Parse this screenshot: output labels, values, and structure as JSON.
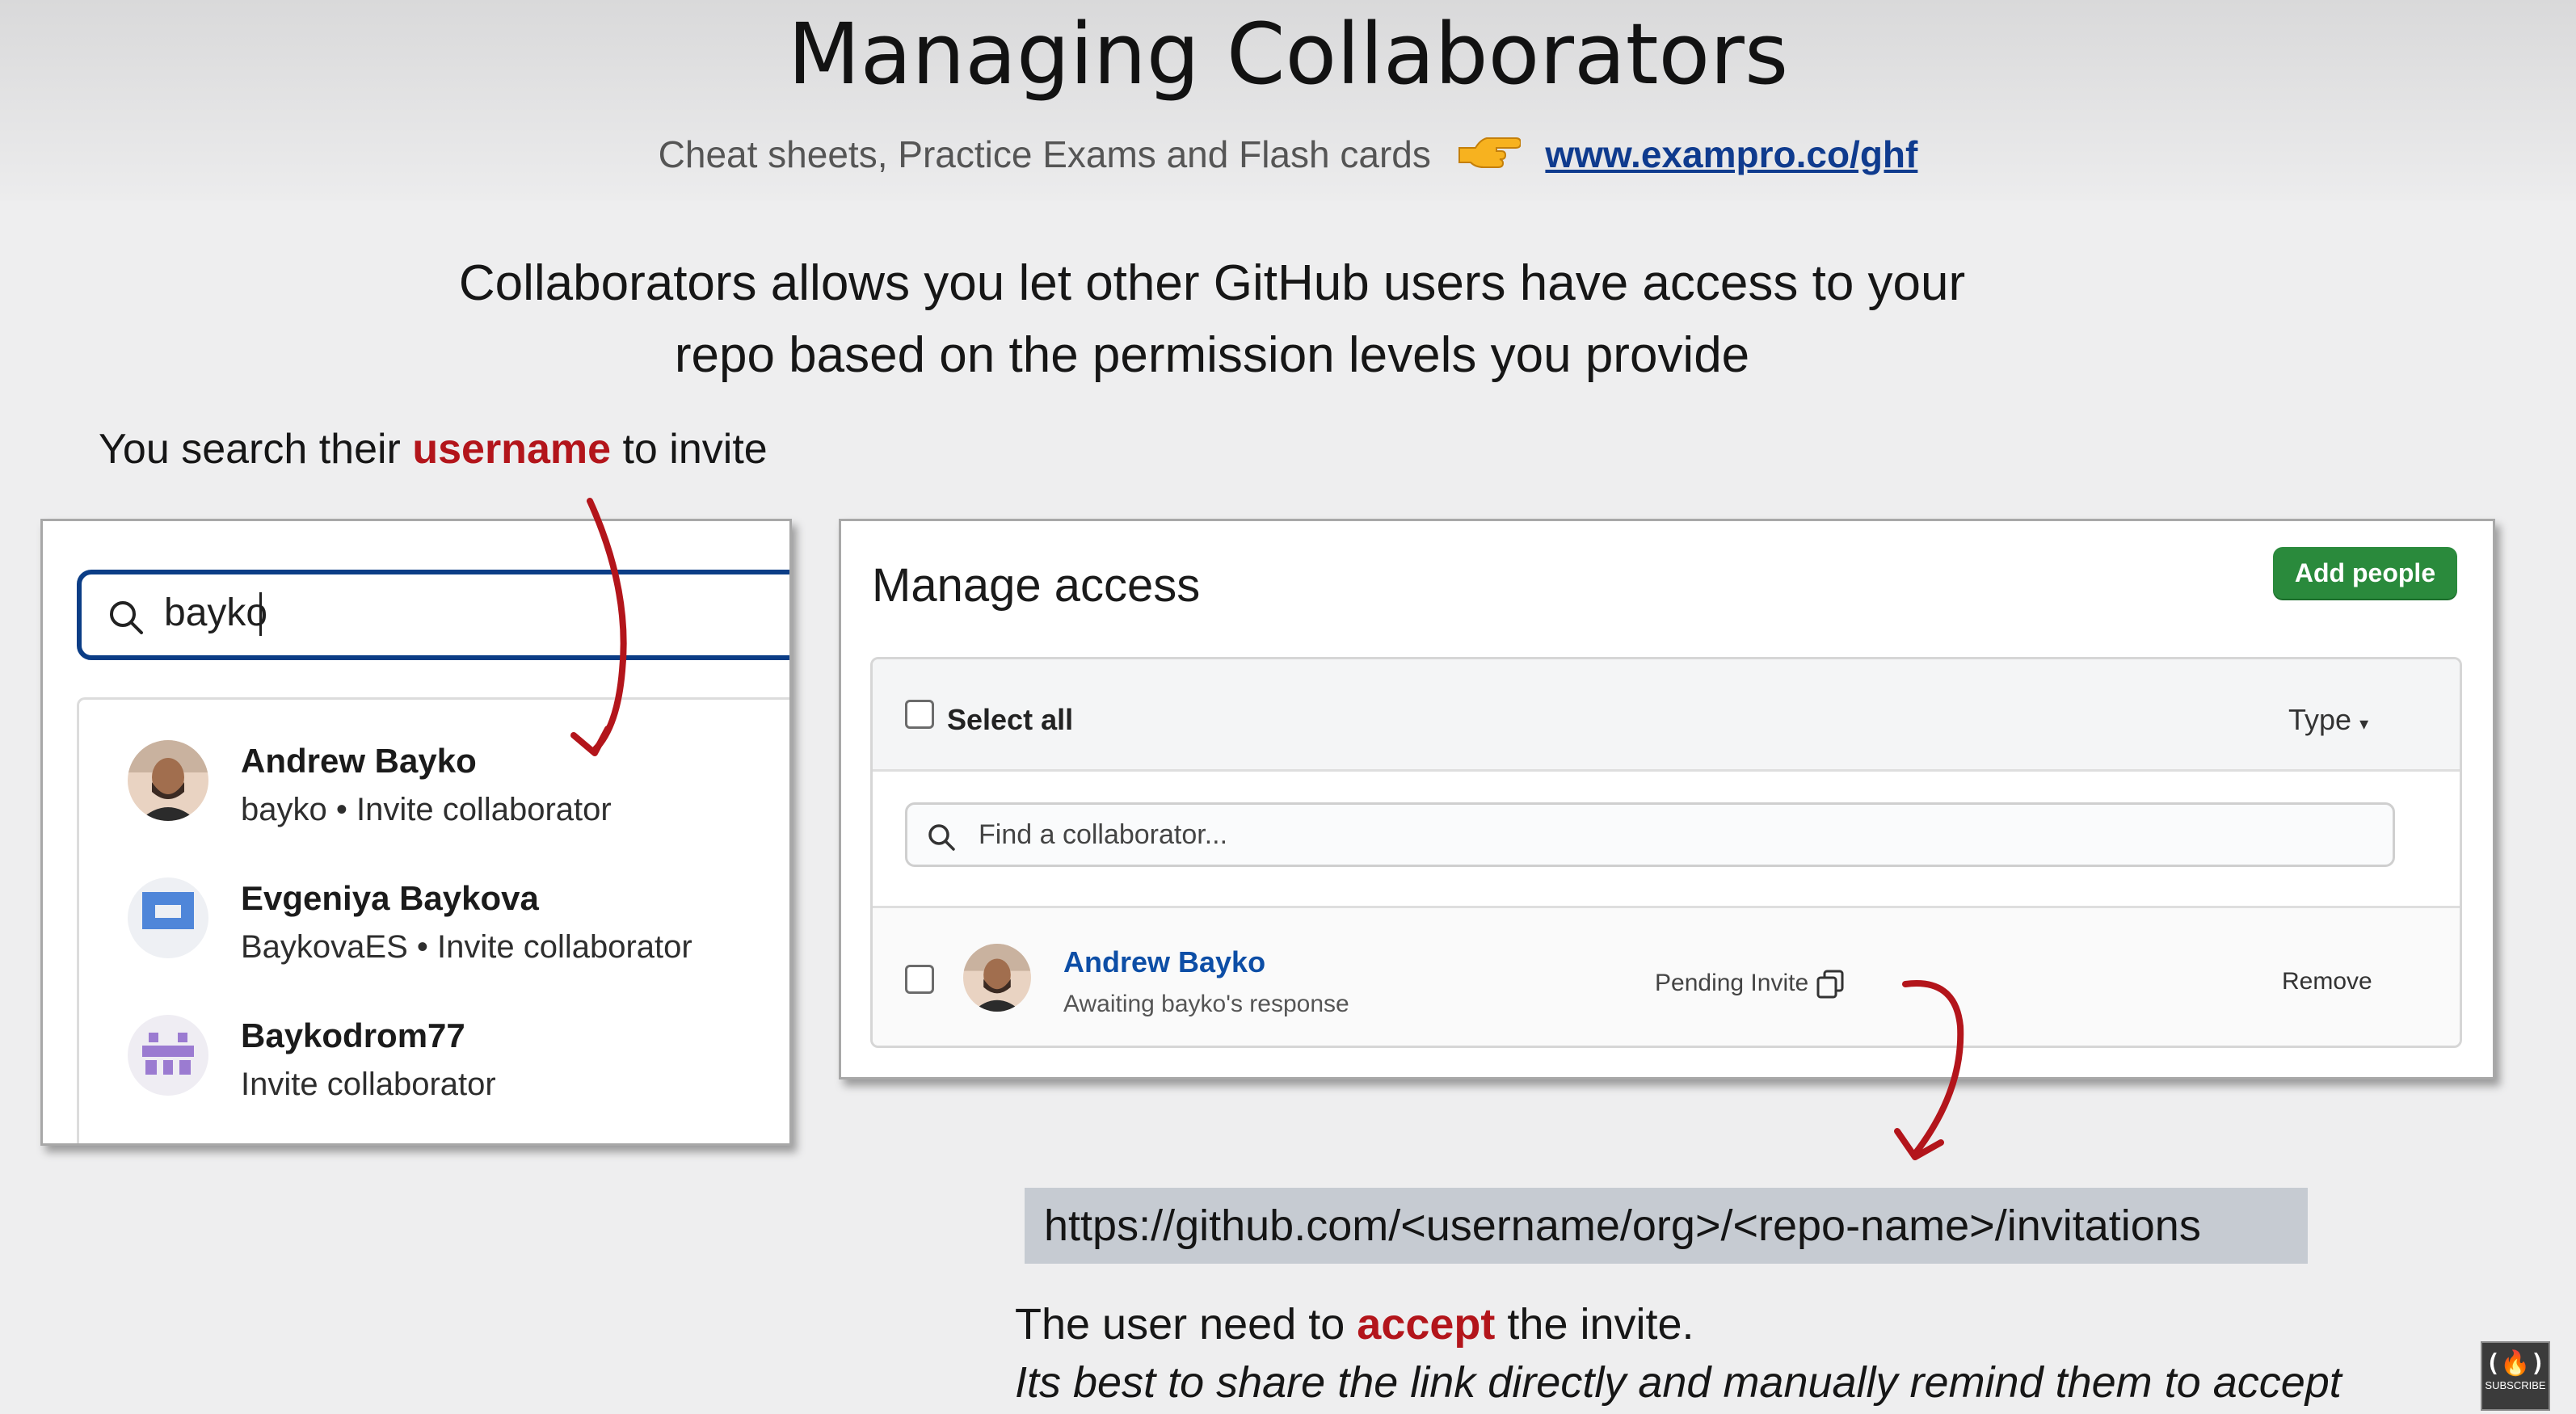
{
  "slide": {
    "title": "Managing Collaborators",
    "subtitle_text": "Cheat sheets, Practice Exams and Flash cards",
    "subtitle_link": "www.exampro.co/ghf",
    "lead_line1": "Collaborators allows you let other GitHub users have access to your",
    "lead_line2": "repo based on the permission levels you provide",
    "search_caption": {
      "before": "You search their",
      "highlight": "username",
      "after": "to invite"
    }
  },
  "search_panel": {
    "query": "bayko",
    "results": [
      {
        "name": "Andrew Bayko",
        "sub": "bayko • Invite collaborator",
        "avatar": "photo-avatar"
      },
      {
        "name": "Evgeniya Baykova",
        "sub": "BaykovaES • Invite collaborator",
        "avatar": "blue-identicon"
      },
      {
        "name": "Baykodrom77",
        "sub": "Invite collaborator",
        "avatar": "purple-identicon"
      }
    ]
  },
  "manage_access": {
    "title": "Manage access",
    "add_button": "Add people",
    "select_all": "Select all",
    "type_filter": "Type",
    "find_placeholder": "Find a collaborator...",
    "row": {
      "name": "Andrew Bayko",
      "sub": "Awaiting bayko's response",
      "status": "Pending Invite",
      "action": "Remove"
    }
  },
  "invite_url": "https://github.com/<username/org>/<repo-name>/invitations",
  "accept_line": {
    "before": "The user need to",
    "highlight": "accept",
    "after": "the invite."
  },
  "tip_line": "Its best to share the link directly and manually remind them to accept",
  "logo": {
    "symbol": "(🔥)",
    "caption": "SUBSCRIBE"
  },
  "colors": {
    "accent_red": "#b3151b",
    "link_blue": "#0f3b8e",
    "button_green": "#2a8a3c",
    "focus_blue": "#0b3d86"
  }
}
